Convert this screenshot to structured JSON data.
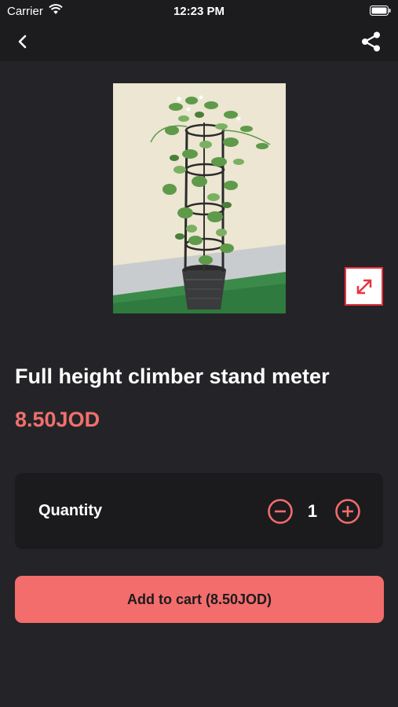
{
  "status_bar": {
    "carrier": "Carrier",
    "time": "12:23 PM"
  },
  "nav": {
    "back_icon": "chevron-left-icon",
    "share_icon": "share-icon"
  },
  "product": {
    "image_alt": "climbing plant in pot with black tower stand",
    "expand_icon": "expand-arrows-icon",
    "title": "Full height climber stand meter",
    "price": "8.50JOD"
  },
  "quantity": {
    "label": "Quantity",
    "value": "1",
    "minus_icon": "minus-circle-icon",
    "plus_icon": "plus-circle-icon"
  },
  "cart": {
    "add_label": "Add to cart (8.50JOD)"
  },
  "colors": {
    "background": "#242428",
    "bar": "#1c1c1f",
    "accent": "#f26d6b",
    "price": "#f0706d",
    "card": "#1b1b1e",
    "expand_border": "#e8343f"
  }
}
